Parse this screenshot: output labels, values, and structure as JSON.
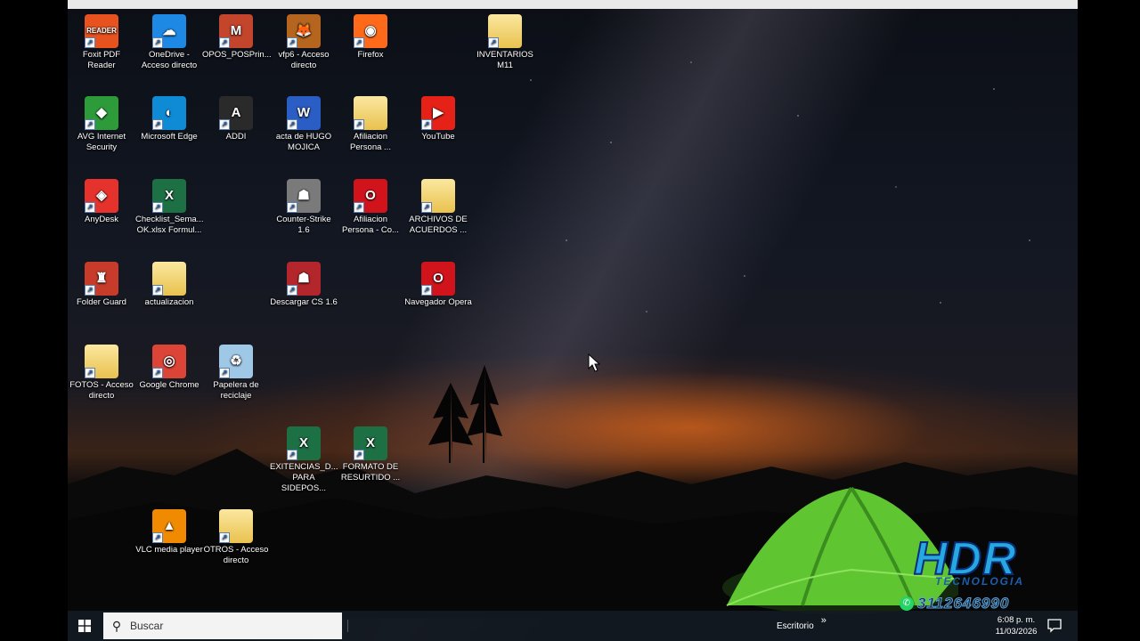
{
  "desktop": {
    "icons": [
      {
        "label": "Foxit PDF Reader",
        "glyph": "READER",
        "color": "#e8521f",
        "icon": "foxit-icon"
      },
      {
        "label": "OneDrive - Acceso directo",
        "glyph": "☁",
        "color": "#1e88e5",
        "icon": "onedrive-icon"
      },
      {
        "label": "OPOS_POSPrin...",
        "glyph": "M",
        "color": "#c2452c",
        "icon": "opos-icon"
      },
      {
        "label": "vfp6 - Acceso directo",
        "glyph": "🦊",
        "color": "#b5651d",
        "icon": "vfp-icon"
      },
      {
        "label": "Firefox",
        "glyph": "◉",
        "color": "#ff6a1a",
        "icon": "firefox-icon"
      },
      {
        "label": "INVENTARIOS M11",
        "glyph": "",
        "color": "folder",
        "icon": "folder-icon"
      },
      {
        "label": "AVG Internet Security",
        "glyph": "◆",
        "color": "#2d9b3a",
        "icon": "avg-icon"
      },
      {
        "label": "Microsoft Edge",
        "glyph": "◐",
        "color": "#0f8bd6",
        "icon": "edge-icon"
      },
      {
        "label": "ADDI",
        "glyph": "A",
        "color": "#2a2a2a",
        "icon": "addi-icon"
      },
      {
        "label": "acta de HUGO MOJICA",
        "glyph": "W",
        "color": "#2b5ec4",
        "icon": "word-icon"
      },
      {
        "label": "Afiliacion Persona ...",
        "glyph": "",
        "color": "folder",
        "icon": "folder-icon"
      },
      {
        "label": "YouTube",
        "glyph": "▶",
        "color": "#e62117",
        "icon": "youtube-icon"
      },
      {
        "label": "AnyDesk",
        "glyph": "◈",
        "color": "#e5322d",
        "icon": "anydesk-icon"
      },
      {
        "label": "Checklist_Sema... OK.xlsx Formul...",
        "glyph": "X",
        "color": "#1d7044",
        "icon": "excel-icon"
      },
      {
        "label": "Counter-Strike 1.6",
        "glyph": "☗",
        "color": "#7a7a7a",
        "icon": "counter-strike-icon"
      },
      {
        "label": "Afiliacion Persona - Co...",
        "glyph": "O",
        "color": "#d1141c",
        "icon": "opera-icon"
      },
      {
        "label": "ARCHIVOS DE ACUERDOS ...",
        "glyph": "",
        "color": "folder",
        "icon": "folder-icon"
      },
      {
        "label": "Folder Guard",
        "glyph": "♜",
        "color": "#c73b2a",
        "icon": "folder-guard-icon"
      },
      {
        "label": "actualizacion",
        "glyph": "",
        "color": "folder",
        "icon": "folder-icon"
      },
      {
        "label": "Descargar CS 1.6",
        "glyph": "☗",
        "color": "#b3262b",
        "icon": "cs-download-icon"
      },
      {
        "label": "Navegador Opera",
        "glyph": "O",
        "color": "#d1141c",
        "icon": "opera-icon"
      },
      {
        "label": "FOTOS - Acceso directo",
        "glyph": "",
        "color": "folder",
        "icon": "folder-icon"
      },
      {
        "label": "Google Chrome",
        "glyph": "◎",
        "color": "#db4437",
        "icon": "chrome-icon"
      },
      {
        "label": "Papelera de reciclaje",
        "glyph": "♻",
        "color": "#9fc7e6",
        "icon": "recycle-bin-icon"
      },
      {
        "label": "EXITENCIAS_D... PARA SIDEPOS...",
        "glyph": "X",
        "color": "#1d7044",
        "icon": "excel-icon"
      },
      {
        "label": "FORMATO DE RESURTIDO ...",
        "glyph": "X",
        "color": "#1d7044",
        "icon": "excel-icon"
      },
      {
        "label": "VLC media player",
        "glyph": "▲",
        "color": "#f08a00",
        "icon": "vlc-icon"
      },
      {
        "label": "OTROS - Acceso directo",
        "glyph": "",
        "color": "folder",
        "icon": "folder-icon"
      }
    ]
  },
  "taskbar": {
    "search_placeholder": "Buscar",
    "toolbar_label": "Escritorio",
    "toolbar_chevron": "»",
    "time": "6:08 p. m.",
    "date": "11/03/2026"
  },
  "watermark": {
    "brand": "HDR",
    "sub": "TECNOLOGIA",
    "phone": "3112646990"
  }
}
